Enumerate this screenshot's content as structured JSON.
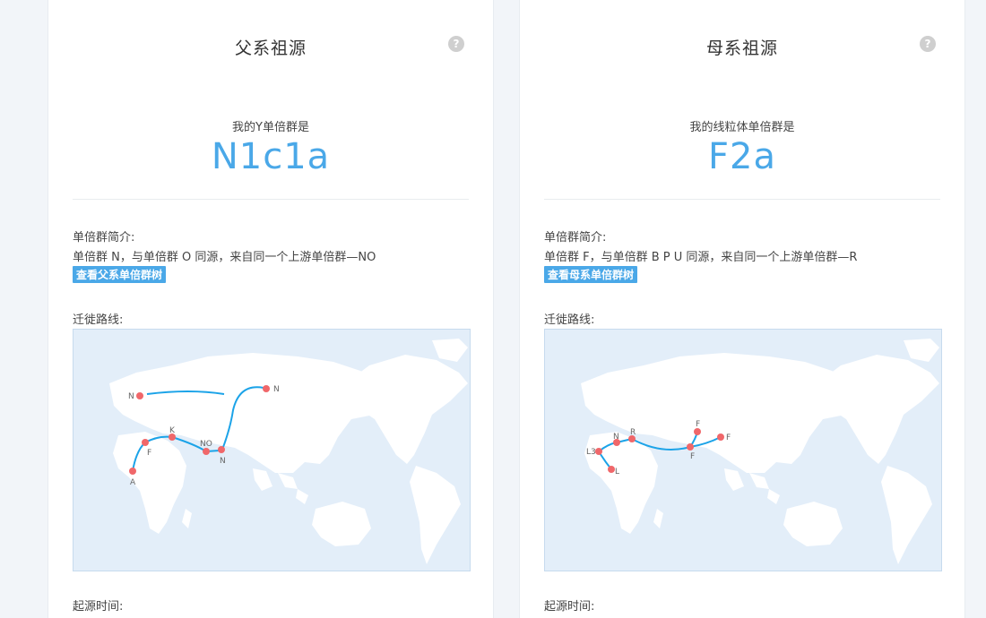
{
  "paternal": {
    "title": "父系祖源",
    "help_icon": "?",
    "haplogroup_label": "我的Y单倍群是",
    "haplogroup": "N1c1a",
    "intro_heading": "单倍群简介:",
    "intro_text": "单倍群 N，与单倍群 O 同源，来自同一个上游单倍群—NO",
    "tree_button": "查看父系单倍群树",
    "route_label": "迁徙路线:",
    "origin_label": "起源时间:",
    "map_points": [
      "A",
      "F",
      "K",
      "NO",
      "N",
      "N",
      "N"
    ]
  },
  "maternal": {
    "title": "母系祖源",
    "help_icon": "?",
    "haplogroup_label": "我的线粒体单倍群是",
    "haplogroup": "F2a",
    "intro_heading": "单倍群简介:",
    "intro_text": "单倍群 F，与单倍群 B P U 同源，来自同一个上游单倍群—R",
    "tree_button": "查看母系单倍群树",
    "route_label": "迁徙路线:",
    "origin_label": "起源时间:",
    "map_points": [
      "L",
      "L3",
      "N",
      "R",
      "F",
      "F",
      "F"
    ]
  },
  "colors": {
    "accent": "#4aa8e8",
    "route": "#1ba3e8",
    "point": "#f0676a",
    "map_bg": "#e3eef9"
  }
}
